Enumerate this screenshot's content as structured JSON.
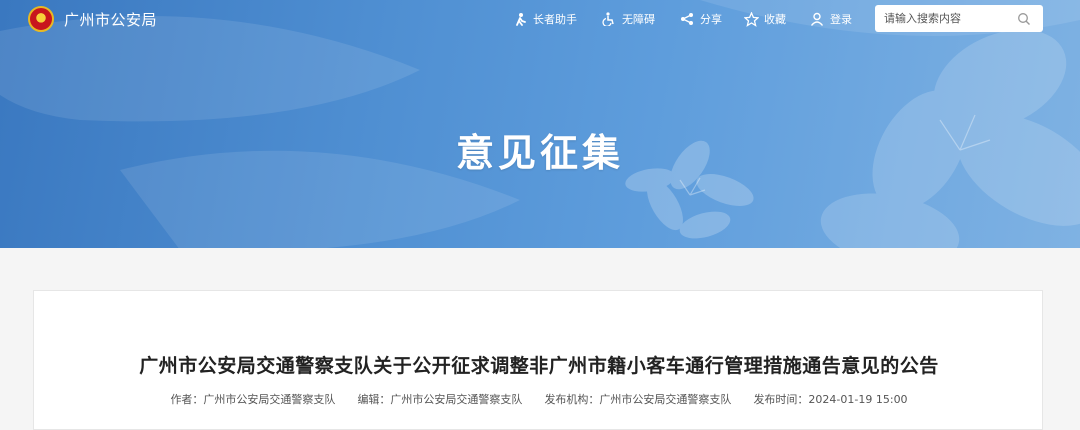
{
  "site": {
    "name": "广州市公安局"
  },
  "nav": {
    "elder": {
      "label": "长者助手",
      "icon": "elder-icon"
    },
    "accessibility": {
      "label": "无障碍",
      "icon": "wheelchair-icon"
    },
    "share": {
      "label": "分享",
      "icon": "share-icon"
    },
    "favorite": {
      "label": "收藏",
      "icon": "star-icon"
    },
    "login": {
      "label": "登录",
      "icon": "user-icon"
    }
  },
  "search": {
    "placeholder": "请输入搜索内容"
  },
  "banner": {
    "title": "意见征集"
  },
  "article": {
    "title": "广州市公安局交通警察支队关于公开征求调整非广州市籍小客车通行管理措施通告意见的公告",
    "meta": {
      "author": "作者：广州市公安局交通警察支队",
      "editor": "编辑：广州市公安局交通警察支队",
      "publisher": "发布机构：广州市公安局交通警察支队",
      "published": "发布时间：2024-01-19 15:00"
    }
  },
  "colors": {
    "hero_blue": "#4f8fd2",
    "text_dark": "#222222"
  }
}
